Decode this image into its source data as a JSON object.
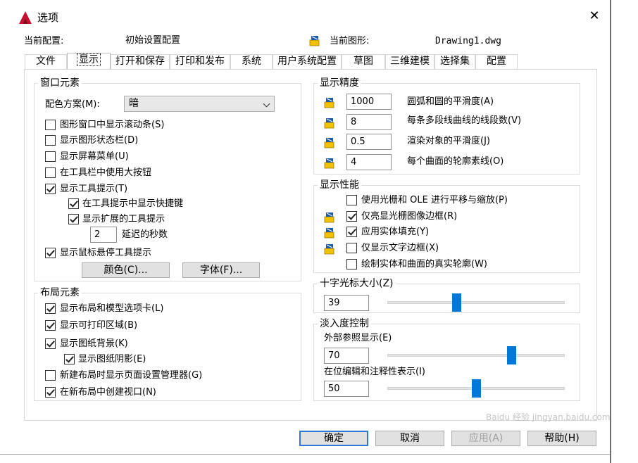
{
  "window": {
    "title": "选项",
    "close_glyph": "✕"
  },
  "profile": {
    "label": "当前配置:",
    "value": "初始设置配置",
    "drawing_label": "当前图形:",
    "drawing_value": "Drawing1.dwg"
  },
  "tabs": [
    "文件",
    "显示",
    "打开和保存",
    "打印和发布",
    "系统",
    "用户系统配置",
    "草图",
    "三维建模",
    "选择集",
    "配置"
  ],
  "window_elements": {
    "legend": "窗口元素",
    "color_scheme_label": "配色方案(M):",
    "color_scheme_value": "暗",
    "items": [
      {
        "label": "图形窗口中显示滚动条(S)",
        "checked": false
      },
      {
        "label": "显示图形状态栏(D)",
        "checked": false
      },
      {
        "label": "显示屏幕菜单(U)",
        "checked": false
      },
      {
        "label": "在工具栏中使用大按钮",
        "checked": false
      },
      {
        "label": "显示工具提示(T)",
        "checked": true
      },
      {
        "label": "在工具提示中显示快捷键",
        "checked": true
      },
      {
        "label": "显示扩展的工具提示",
        "checked": true
      },
      {
        "label": "显示鼠标悬停工具提示",
        "checked": true
      }
    ],
    "delay_value": "2",
    "delay_label": "延迟的秒数",
    "colors_button": "颜色(C)...",
    "fonts_button": "字体(F)..."
  },
  "layout_elements": {
    "legend": "布局元素",
    "items": [
      {
        "label": "显示布局和模型选项卡(L)",
        "checked": true
      },
      {
        "label": "显示可打印区域(B)",
        "checked": true
      },
      {
        "label": "显示图纸背景(K)",
        "checked": true
      },
      {
        "label": "显示图纸阴影(E)",
        "checked": true
      },
      {
        "label": "新建布局时显示页面设置管理器(G)",
        "checked": false
      },
      {
        "label": "在新布局中创建视口(N)",
        "checked": true
      }
    ]
  },
  "display_resolution": {
    "legend": "显示精度",
    "items": [
      {
        "value": "1000",
        "label": "圆弧和圆的平滑度(A)"
      },
      {
        "value": "8",
        "label": "每条多段线曲线的线段数(V)"
      },
      {
        "value": "0.5",
        "label": "渲染对象的平滑度(J)"
      },
      {
        "value": "4",
        "label": "每个曲面的轮廓素线(O)"
      }
    ]
  },
  "display_performance": {
    "legend": "显示性能",
    "items": [
      {
        "label": "使用光栅和 OLE 进行平移与缩放(P)",
        "checked": false
      },
      {
        "label": "仅亮显光栅图像边框(R)",
        "checked": true
      },
      {
        "label": "应用实体填充(Y)",
        "checked": true
      },
      {
        "label": "仅显示文字边框(X)",
        "checked": false
      },
      {
        "label": "绘制实体和曲面的真实轮廓(W)",
        "checked": false
      }
    ]
  },
  "crosshair": {
    "legend": "十字光标大小(Z)",
    "value": "39",
    "level": 0.39
  },
  "fade": {
    "legend": "淡入度控制",
    "xref_label": "外部参照显示(E)",
    "xref_value": "70",
    "xref_level": 0.7,
    "inplace_label": "在位编辑和注释性表示(I)",
    "inplace_value": "50",
    "inplace_level": 0.5
  },
  "buttons": {
    "ok": "确定",
    "cancel": "取消",
    "apply": "应用(A)",
    "help": "帮助(H)"
  },
  "watermark": "Baidu 经验 jingyan.baidu.com",
  "colors": {
    "accent": "#0078d7",
    "icon_yellow": "#f2c200",
    "app_red": "#c8102e"
  }
}
